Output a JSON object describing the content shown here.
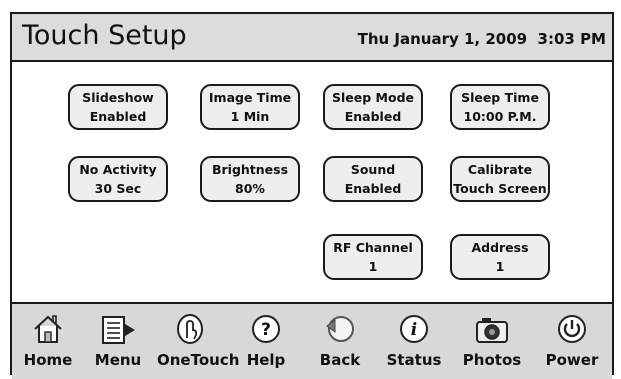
{
  "header": {
    "title": "Touch Setup",
    "datetime": "Thu January 1, 2009  3:03 PM"
  },
  "settings": [
    {
      "line1": "Slideshow",
      "line2": "Enabled"
    },
    {
      "line1": "Image Time",
      "line2": "1 Min"
    },
    {
      "line1": "Sleep Mode",
      "line2": "Enabled"
    },
    {
      "line1": "Sleep Time",
      "line2": "10:00 P.M."
    },
    {
      "line1": "No Activity",
      "line2": "30 Sec"
    },
    {
      "line1": "Brightness",
      "line2": "80%"
    },
    {
      "line1": "Sound",
      "line2": "Enabled"
    },
    {
      "line1": "Calibrate",
      "line2": "Touch Screen"
    },
    {
      "line1": "RF Channel",
      "line2": "1"
    },
    {
      "line1": "Address",
      "line2": "1"
    }
  ],
  "dock": [
    {
      "label": "Home",
      "icon": "home-icon"
    },
    {
      "label": "Menu",
      "icon": "menu-icon"
    },
    {
      "label": "OneTouch",
      "icon": "touch-icon"
    },
    {
      "label": "Help",
      "icon": "help-icon"
    },
    {
      "label": "Back",
      "icon": "back-icon"
    },
    {
      "label": "Status",
      "icon": "info-icon"
    },
    {
      "label": "Photos",
      "icon": "camera-icon"
    },
    {
      "label": "Power",
      "icon": "power-icon"
    }
  ],
  "colors": {
    "header_bg": "#dcdcdc",
    "dock_bg": "#d8d8d8",
    "button_bg": "#eeeeee",
    "outline": "#1a1a1a"
  }
}
